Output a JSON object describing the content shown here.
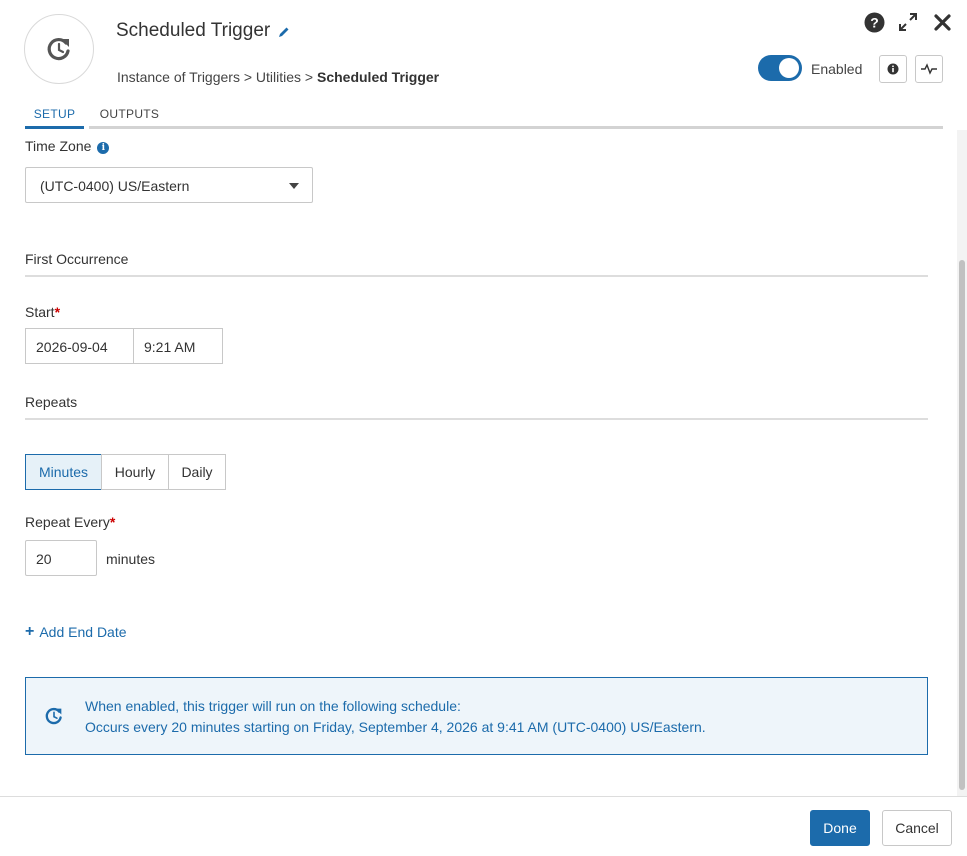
{
  "header": {
    "title": "Scheduled Trigger",
    "breadcrumb_prefix": "Instance of Triggers > Utilities > ",
    "breadcrumb_current": "Scheduled Trigger",
    "enabled_label": "Enabled",
    "enabled": true
  },
  "tabs": [
    {
      "label": "SETUP",
      "active": true
    },
    {
      "label": "OUTPUTS",
      "active": false
    }
  ],
  "form": {
    "time_zone_label": "Time Zone",
    "time_zone_value": "(UTC-0400) US/Eastern",
    "first_occurrence_title": "First Occurrence",
    "start_label": "Start",
    "start_date": "2026-09-04",
    "start_time": "9:21 AM",
    "repeats_title": "Repeats",
    "repeat_options": [
      "Minutes",
      "Hourly",
      "Daily"
    ],
    "repeat_selected": "Minutes",
    "repeat_every_label": "Repeat Every",
    "repeat_every_value": "20",
    "repeat_every_unit": "minutes",
    "add_end_date": "Add End Date"
  },
  "schedule_info": {
    "line1": "When enabled, this trigger will run on the following schedule:",
    "line2": "Occurs every 20 minutes starting on Friday, September 4, 2026 at 9:41 AM (UTC-0400) US/Eastern."
  },
  "footer": {
    "done_label": "Done",
    "cancel_label": "Cancel"
  },
  "colors": {
    "accent": "#1c6bab",
    "required": "#cc0000",
    "info_bg": "#eef5fa"
  }
}
